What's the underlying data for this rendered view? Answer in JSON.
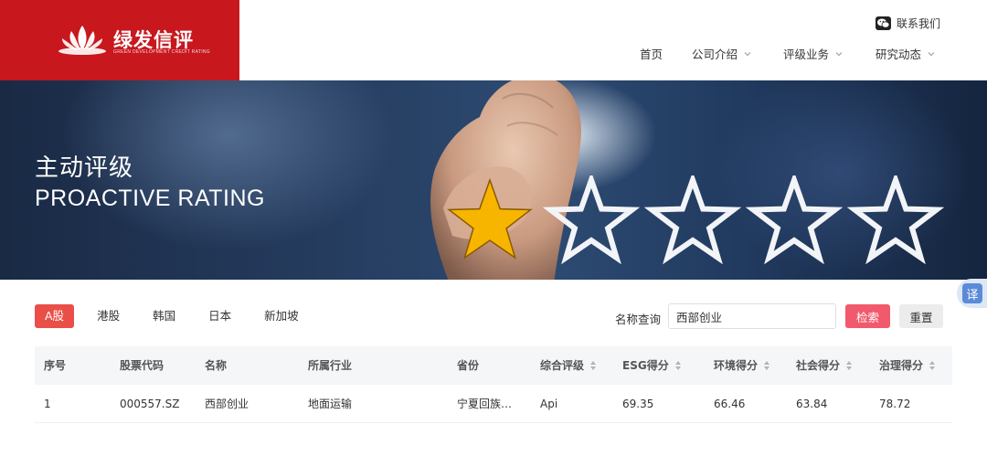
{
  "brand": {
    "name_cn": "绿发信评",
    "name_en": "GREEN DEVELOPMENT CREDIT RATING",
    "color": "#c8171d"
  },
  "header": {
    "contact_label": "联系我们",
    "nav": [
      {
        "label": "首页",
        "has_dropdown": false
      },
      {
        "label": "公司介绍",
        "has_dropdown": true
      },
      {
        "label": "评级业务",
        "has_dropdown": true
      },
      {
        "label": "研究动态",
        "has_dropdown": true
      }
    ]
  },
  "banner": {
    "title_cn": "主动评级",
    "title_en": "PROACTIVE RATING",
    "stars_total": 5,
    "stars_filled": 1
  },
  "translate": {
    "label": "译"
  },
  "filters": {
    "markets": [
      "A股",
      "港股",
      "韩国",
      "日本",
      "新加坡"
    ],
    "active_market": "A股",
    "search_label": "名称查询",
    "search_value": "西部创业",
    "search_button": "检索",
    "reset_button": "重置"
  },
  "table": {
    "columns": [
      {
        "label": "序号",
        "sortable": false
      },
      {
        "label": "股票代码",
        "sortable": false
      },
      {
        "label": "名称",
        "sortable": false
      },
      {
        "label": "所属行业",
        "sortable": false
      },
      {
        "label": "省份",
        "sortable": false
      },
      {
        "label": "综合评级",
        "sortable": true
      },
      {
        "label": "ESG得分",
        "sortable": true
      },
      {
        "label": "环境得分",
        "sortable": true
      },
      {
        "label": "社会得分",
        "sortable": true
      },
      {
        "label": "治理得分",
        "sortable": true
      }
    ],
    "rows": [
      [
        "1",
        "000557.SZ",
        "西部创业",
        "地面运输",
        "宁夏回族…",
        "Api",
        "69.35",
        "66.46",
        "63.84",
        "78.72"
      ]
    ]
  },
  "colors": {
    "accent_red": "#ea4f47",
    "search_button": "#f15a6d",
    "star_filled": "#f7b500"
  }
}
